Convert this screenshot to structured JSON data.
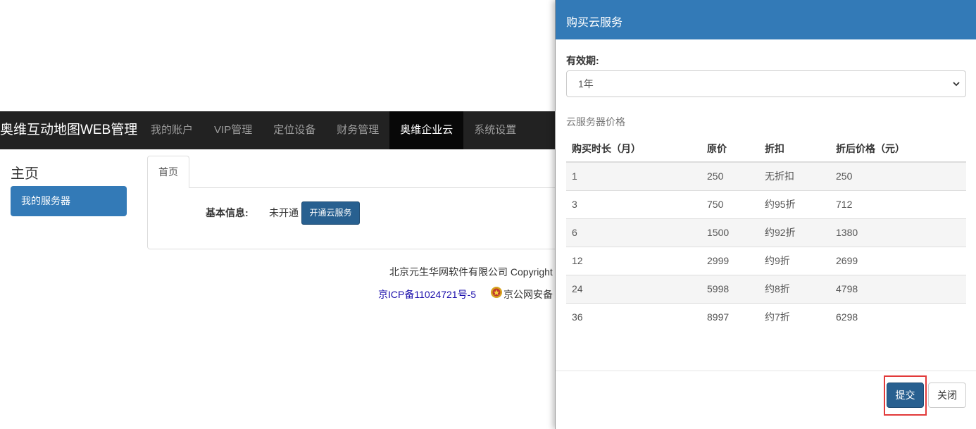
{
  "navbar": {
    "brand": "奥维互动地图WEB管理",
    "items": [
      {
        "label": "我的账户"
      },
      {
        "label": "VIP管理"
      },
      {
        "label": "定位设备"
      },
      {
        "label": "财务管理"
      },
      {
        "label": "奥维企业云",
        "active": true
      },
      {
        "label": "系统设置"
      }
    ]
  },
  "sidebar": {
    "title": "主页",
    "button": "我的服务器"
  },
  "main": {
    "tab": "首页",
    "info_label": "基本信息:",
    "info_value": "未开通",
    "open_button": "开通云服务"
  },
  "footer": {
    "copyright": "北京元生华网软件有限公司 Copyright",
    "icp": "京ICP备11024721号-5",
    "police": "京公网安备"
  },
  "modal": {
    "title": "购买云服务",
    "validity_label": "有效期:",
    "validity_value": "1年",
    "section_label": "云服务器价格",
    "table": {
      "headers": [
        "购买时长（月）",
        "原价",
        "折扣",
        "折后价格（元）"
      ],
      "rows": [
        [
          "1",
          "250",
          "无折扣",
          "250"
        ],
        [
          "3",
          "750",
          "约95折",
          "712"
        ],
        [
          "6",
          "1500",
          "约92折",
          "1380"
        ],
        [
          "12",
          "2999",
          "约9折",
          "2699"
        ],
        [
          "24",
          "5998",
          "约8折",
          "4798"
        ],
        [
          "36",
          "8997",
          "约7折",
          "6298"
        ]
      ]
    },
    "submit_button": "提交",
    "close_button": "关闭"
  },
  "colors": {
    "primary": "#337ab7",
    "primary_dark": "#286090",
    "navbar": "#222222",
    "highlight": "#e23a3a"
  }
}
